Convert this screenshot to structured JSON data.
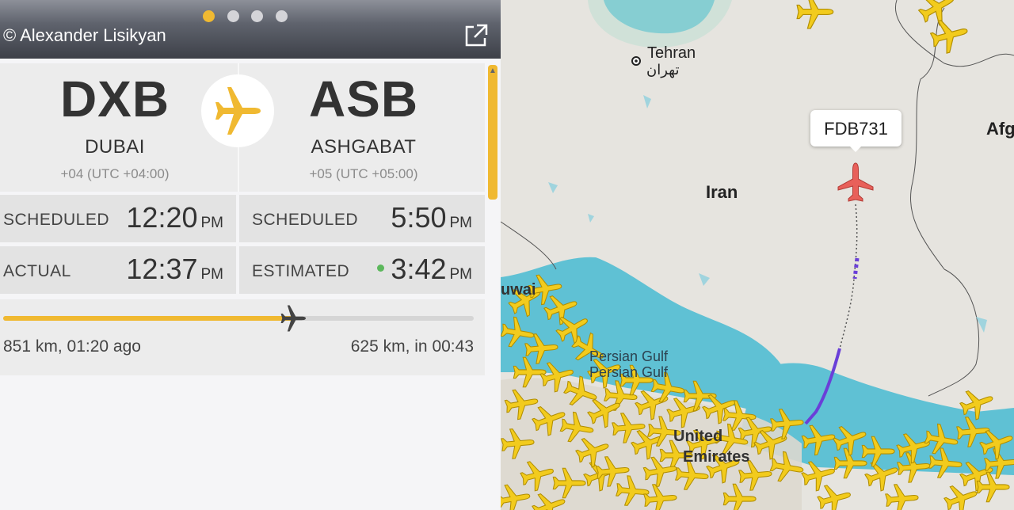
{
  "header": {
    "credit": "© Alexander Lisikyan",
    "carousel_dots": 4,
    "active_dot": 0,
    "icon": "external-link-icon"
  },
  "departure": {
    "code": "DXB",
    "city": "DUBAI",
    "timezone": "+04 (UTC +04:00)"
  },
  "arrival": {
    "code": "ASB",
    "city": "ASHGABAT",
    "timezone": "+05 (UTC +05:00)"
  },
  "times": {
    "dep_scheduled": {
      "label": "SCHEDULED",
      "time": "12:20",
      "ampm": "PM"
    },
    "dep_actual": {
      "label": "ACTUAL",
      "time": "12:37",
      "ampm": "PM"
    },
    "arr_scheduled": {
      "label": "SCHEDULED",
      "time": "5:50",
      "ampm": "PM"
    },
    "arr_estimated": {
      "label": "ESTIMATED",
      "time": "3:42",
      "ampm": "PM",
      "indicator_color": "#5cb85c"
    }
  },
  "progress": {
    "fraction": 0.617,
    "flown": "851 km, 01:20 ago",
    "remaining": "625 km, in 00:43"
  },
  "map": {
    "city_label": "Tehran",
    "city_label_fa": "تهران",
    "country_label": "Iran",
    "country_label_partial": "Afg",
    "kuwait_partial": "uwai",
    "sea_label_1": "Persian Gulf",
    "sea_label_2": "Persian Gulf",
    "uae_partial_1": "United",
    "uae_partial_2": "Emirates",
    "selected_flight": "FDB731",
    "colors": {
      "land": "#e6e4df",
      "water": "#5fc1d4",
      "aircraft": "#f2cb1d",
      "selected": "#e8605a",
      "track": "#6a3fd8"
    }
  },
  "colors": {
    "accent": "#f0b931",
    "panel": "#ececec"
  }
}
